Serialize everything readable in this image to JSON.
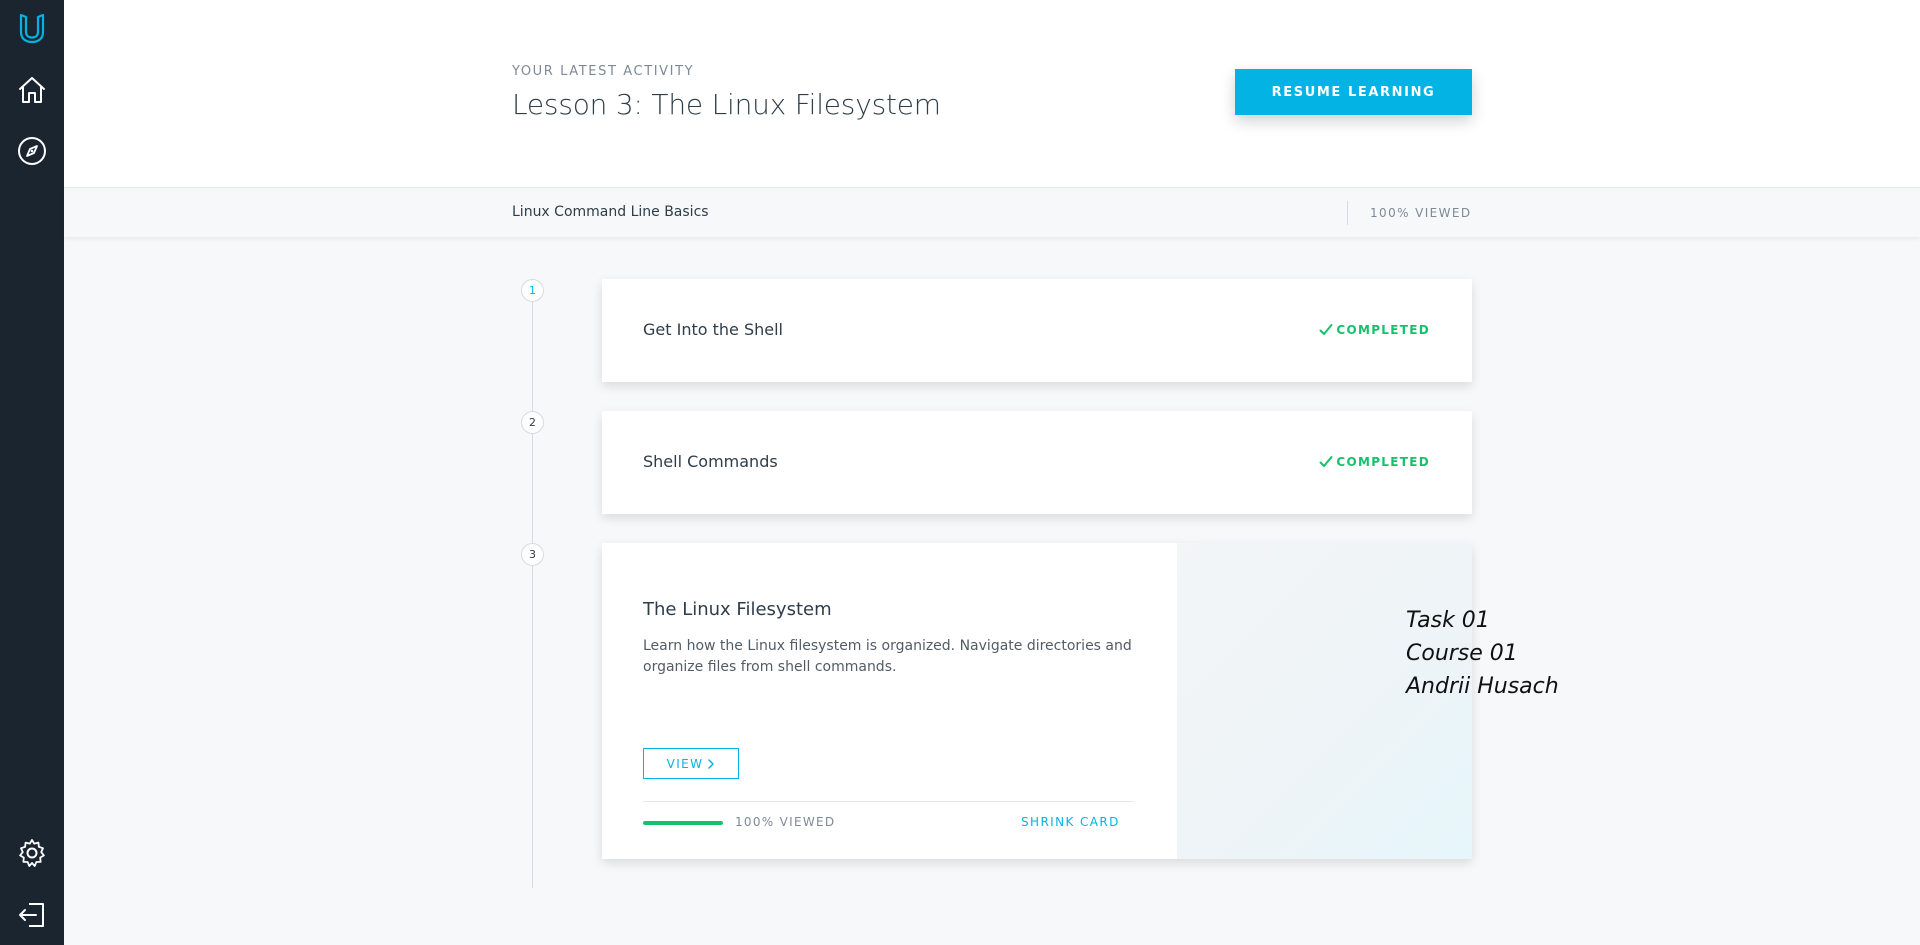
{
  "sidebar": {
    "logo_icon": "udacity-logo-icon",
    "items": [
      {
        "icon": "home-icon"
      },
      {
        "icon": "compass-icon"
      }
    ],
    "bottom_items": [
      {
        "icon": "gear-icon"
      },
      {
        "icon": "logout-icon"
      }
    ]
  },
  "header": {
    "eyebrow": "YOUR LATEST ACTIVITY",
    "lesson_title": "Lesson 3: The Linux Filesystem",
    "resume_label": "RESUME LEARNING"
  },
  "subbar": {
    "course_name": "Linux Command Line Basics",
    "viewed": "100% VIEWED"
  },
  "concepts": [
    {
      "number": "1",
      "title": "Get Into the Shell",
      "status": "COMPLETED"
    },
    {
      "number": "2",
      "title": "Shell Commands",
      "status": "COMPLETED"
    },
    {
      "number": "3",
      "title": "The Linux Filesystem",
      "description": "Learn how the Linux filesystem is organized. Navigate directories and organize files from shell commands.",
      "view_label": "VIEW",
      "progress_percent": 100,
      "progress_label": "100% VIEWED",
      "shrink_label": "SHRINK CARD"
    }
  ],
  "overlay_note": {
    "line1": "Task 01",
    "line2": "Course 01",
    "line3": "Andrii Husach"
  },
  "colors": {
    "sidebar_bg": "#1b2530",
    "accent": "#02b3e4",
    "success": "#15c26b"
  }
}
